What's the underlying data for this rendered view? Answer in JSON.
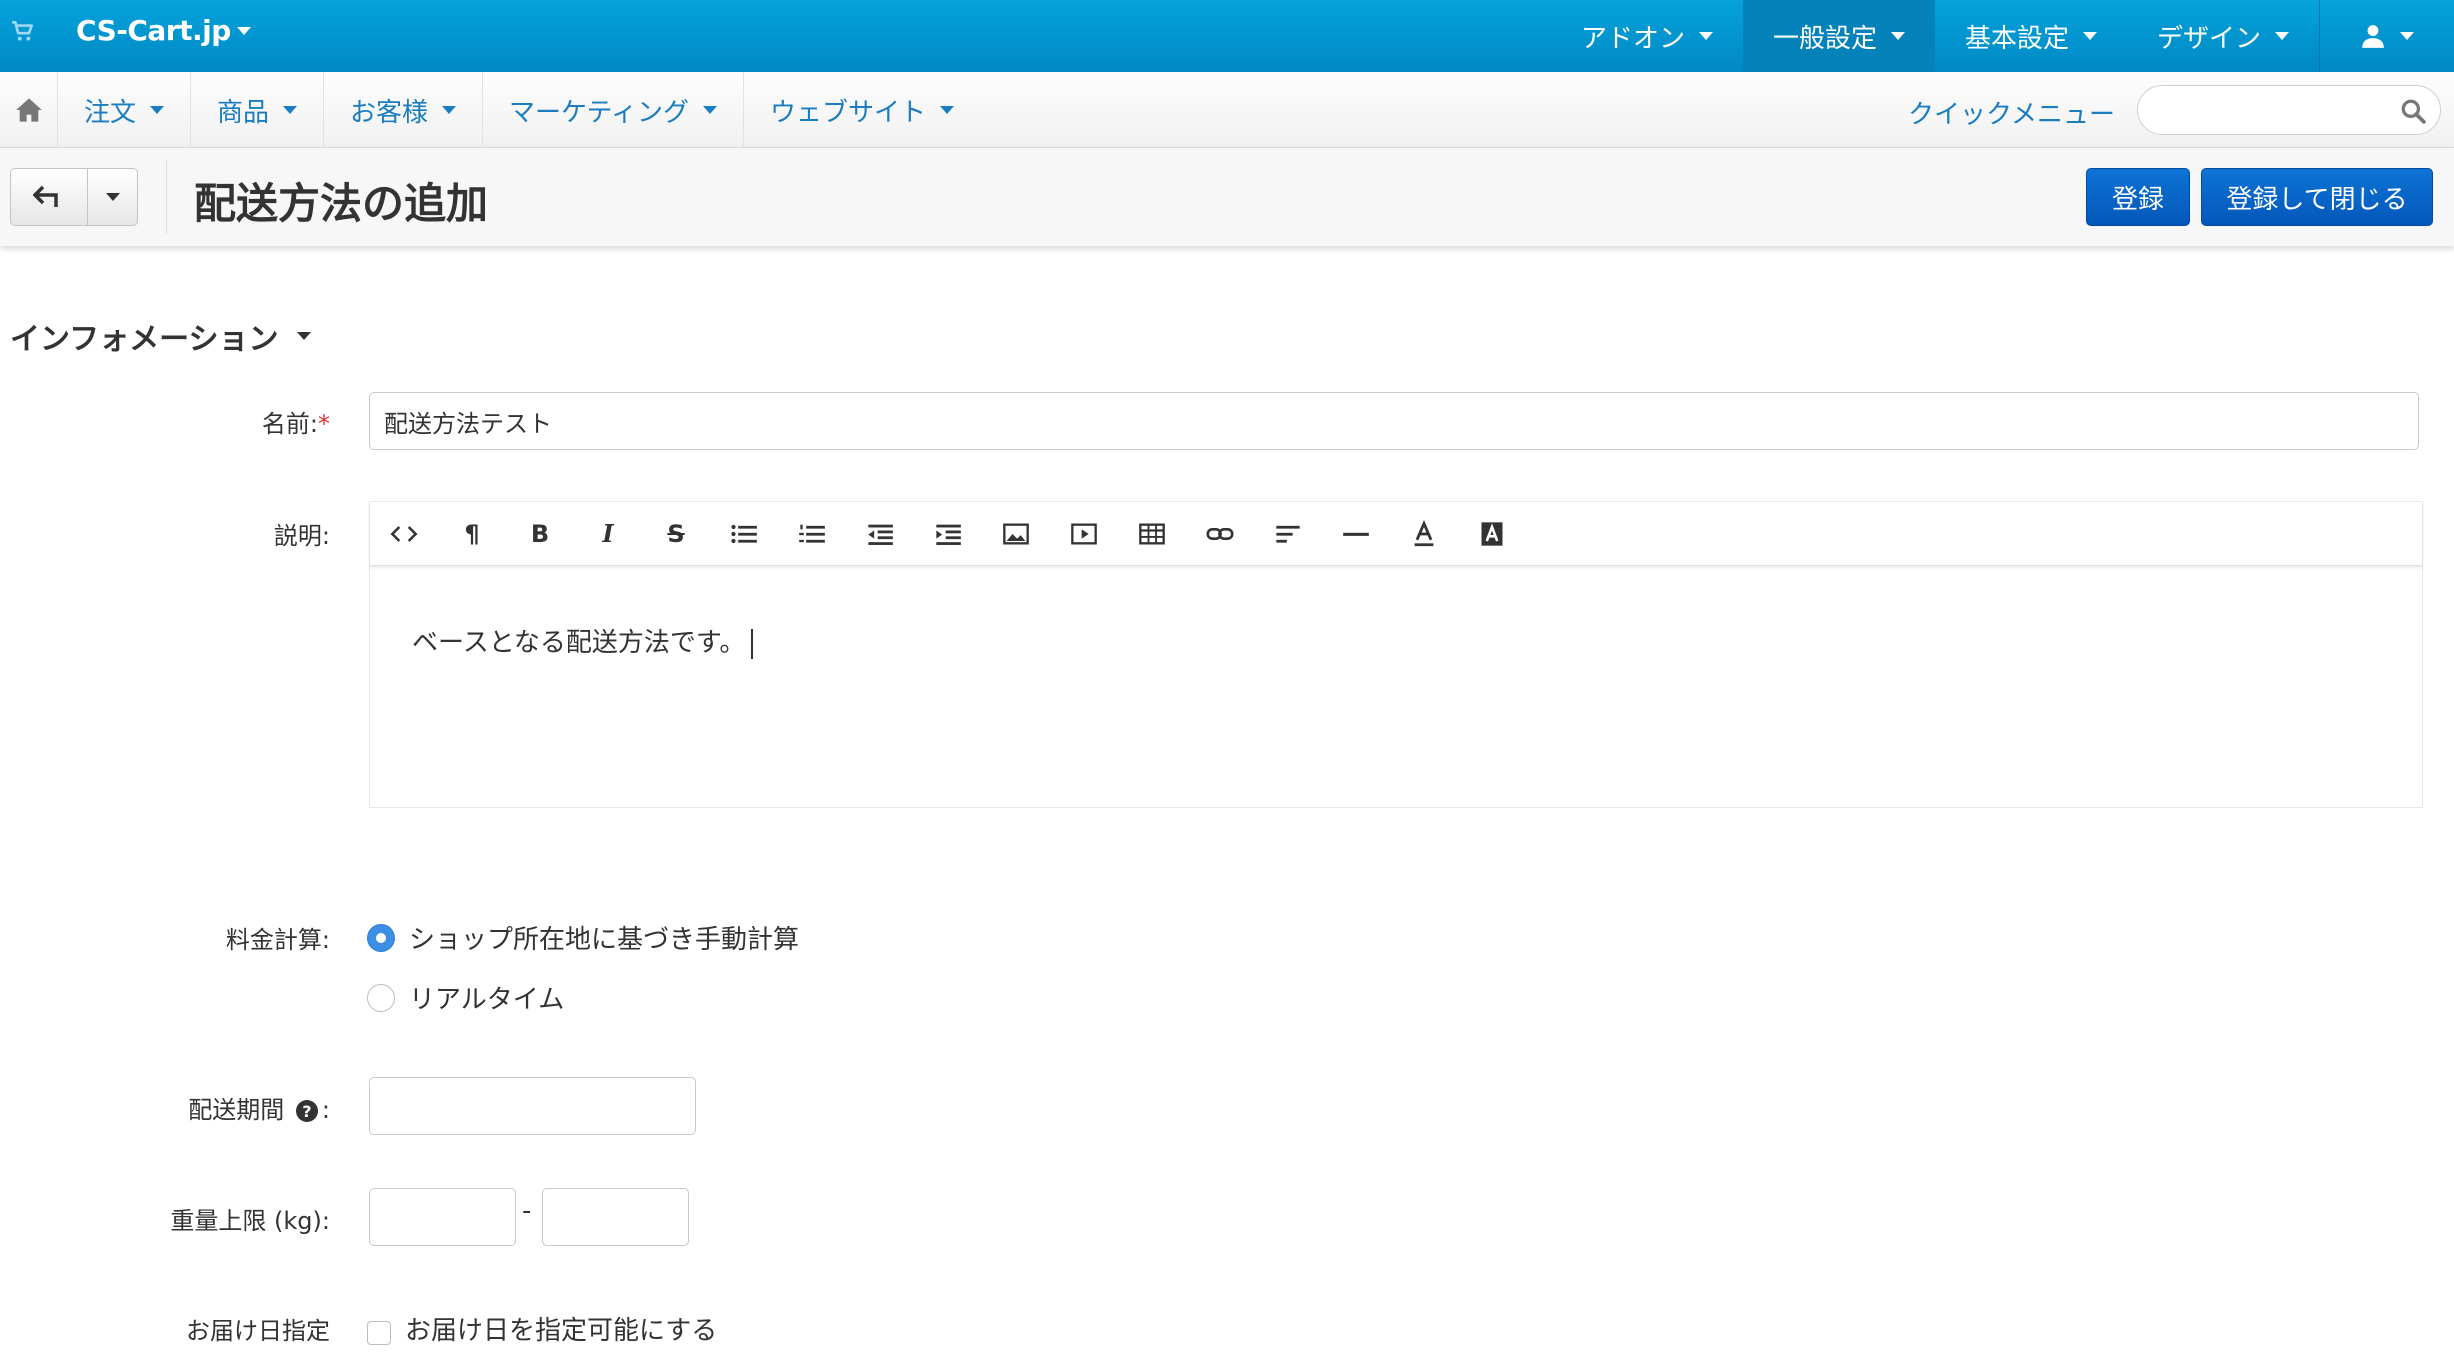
{
  "topbar": {
    "brand": "CS-Cart.jp",
    "nav": [
      {
        "label": "アドオン"
      },
      {
        "label": "一般設定"
      },
      {
        "label": "基本設定"
      },
      {
        "label": "デザイン"
      }
    ]
  },
  "mainnav": {
    "items": [
      {
        "label": "注文"
      },
      {
        "label": "商品"
      },
      {
        "label": "お客様"
      },
      {
        "label": "マーケティング"
      },
      {
        "label": "ウェブサイト"
      }
    ],
    "quick_menu": "クイックメニュー",
    "search_placeholder": ""
  },
  "actionbar": {
    "title": "配送方法の追加",
    "save_label": "登録",
    "save_close_label": "登録して閉じる"
  },
  "form": {
    "section_title": "インフォメーション",
    "name_label": "名前:",
    "name_required": "*",
    "name_value": "配送方法テスト",
    "description_label": "説明:",
    "description_text": "ベースとなる配送方法です。",
    "rate_label": "料金計算:",
    "rate_options": [
      {
        "label": "ショップ所在地に基づき手動計算",
        "checked": true
      },
      {
        "label": "リアルタイム",
        "checked": false
      }
    ],
    "delivery_time_label": "配送期間",
    "delivery_time_colon": ":",
    "delivery_time_value": "",
    "weight_label": "重量上限 (kg):",
    "weight_min": "",
    "weight_max": "",
    "weight_separator": "-",
    "delivery_date_label": "お届け日指定",
    "delivery_date_checkbox_label": "お届け日を指定可能にする",
    "delivery_date_checked": false
  },
  "colors": {
    "topbar": "#0596d2",
    "link": "#1b7dc0",
    "primary_button": "#0a65c8",
    "radio_checked": "#3d8fe5"
  }
}
